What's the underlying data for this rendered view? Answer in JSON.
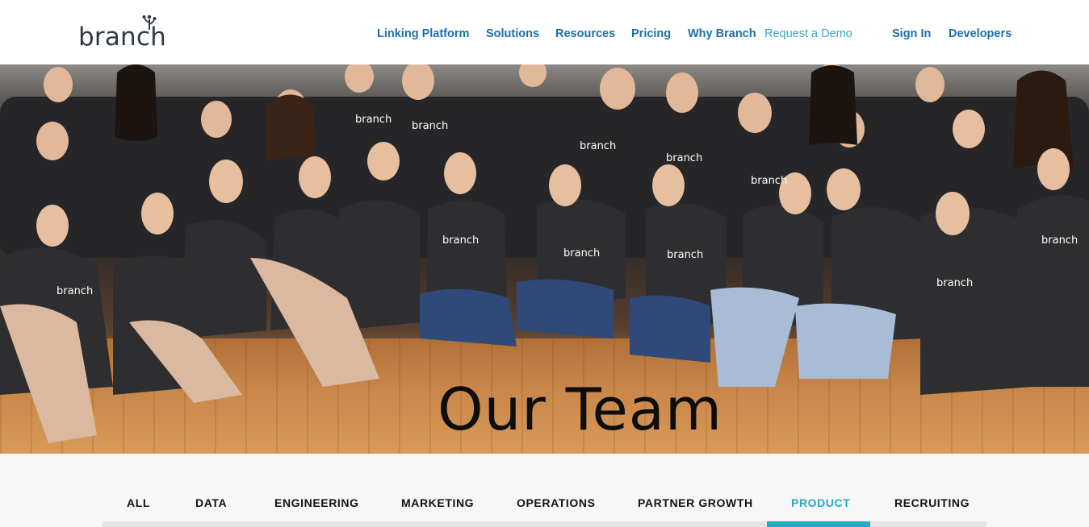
{
  "header": {
    "logo_text": "branch",
    "nav": {
      "linking_platform": "Linking Platform",
      "solutions": "Solutions",
      "resources": "Resources",
      "pricing": "Pricing",
      "why_branch": "Why Branch",
      "request_demo": "Request a Demo",
      "sign_in": "Sign In",
      "developers": "Developers"
    }
  },
  "hero": {
    "title": "Our Team",
    "image_icon": "team-photo",
    "shirt_logo": "branch"
  },
  "filters": {
    "tabs": [
      {
        "label": "ALL"
      },
      {
        "label": "DATA"
      },
      {
        "label": "ENGINEERING"
      },
      {
        "label": "MARKETING"
      },
      {
        "label": "OPERATIONS"
      },
      {
        "label": "PARTNER GROWTH"
      },
      {
        "label": "PRODUCT"
      },
      {
        "label": "RECRUITING"
      }
    ],
    "active": "PRODUCT"
  },
  "colors": {
    "nav_link": "#1b6fa8",
    "demo_link": "#3aa6c6",
    "accent": "#26a9c4",
    "logo": "#2f3a44"
  }
}
